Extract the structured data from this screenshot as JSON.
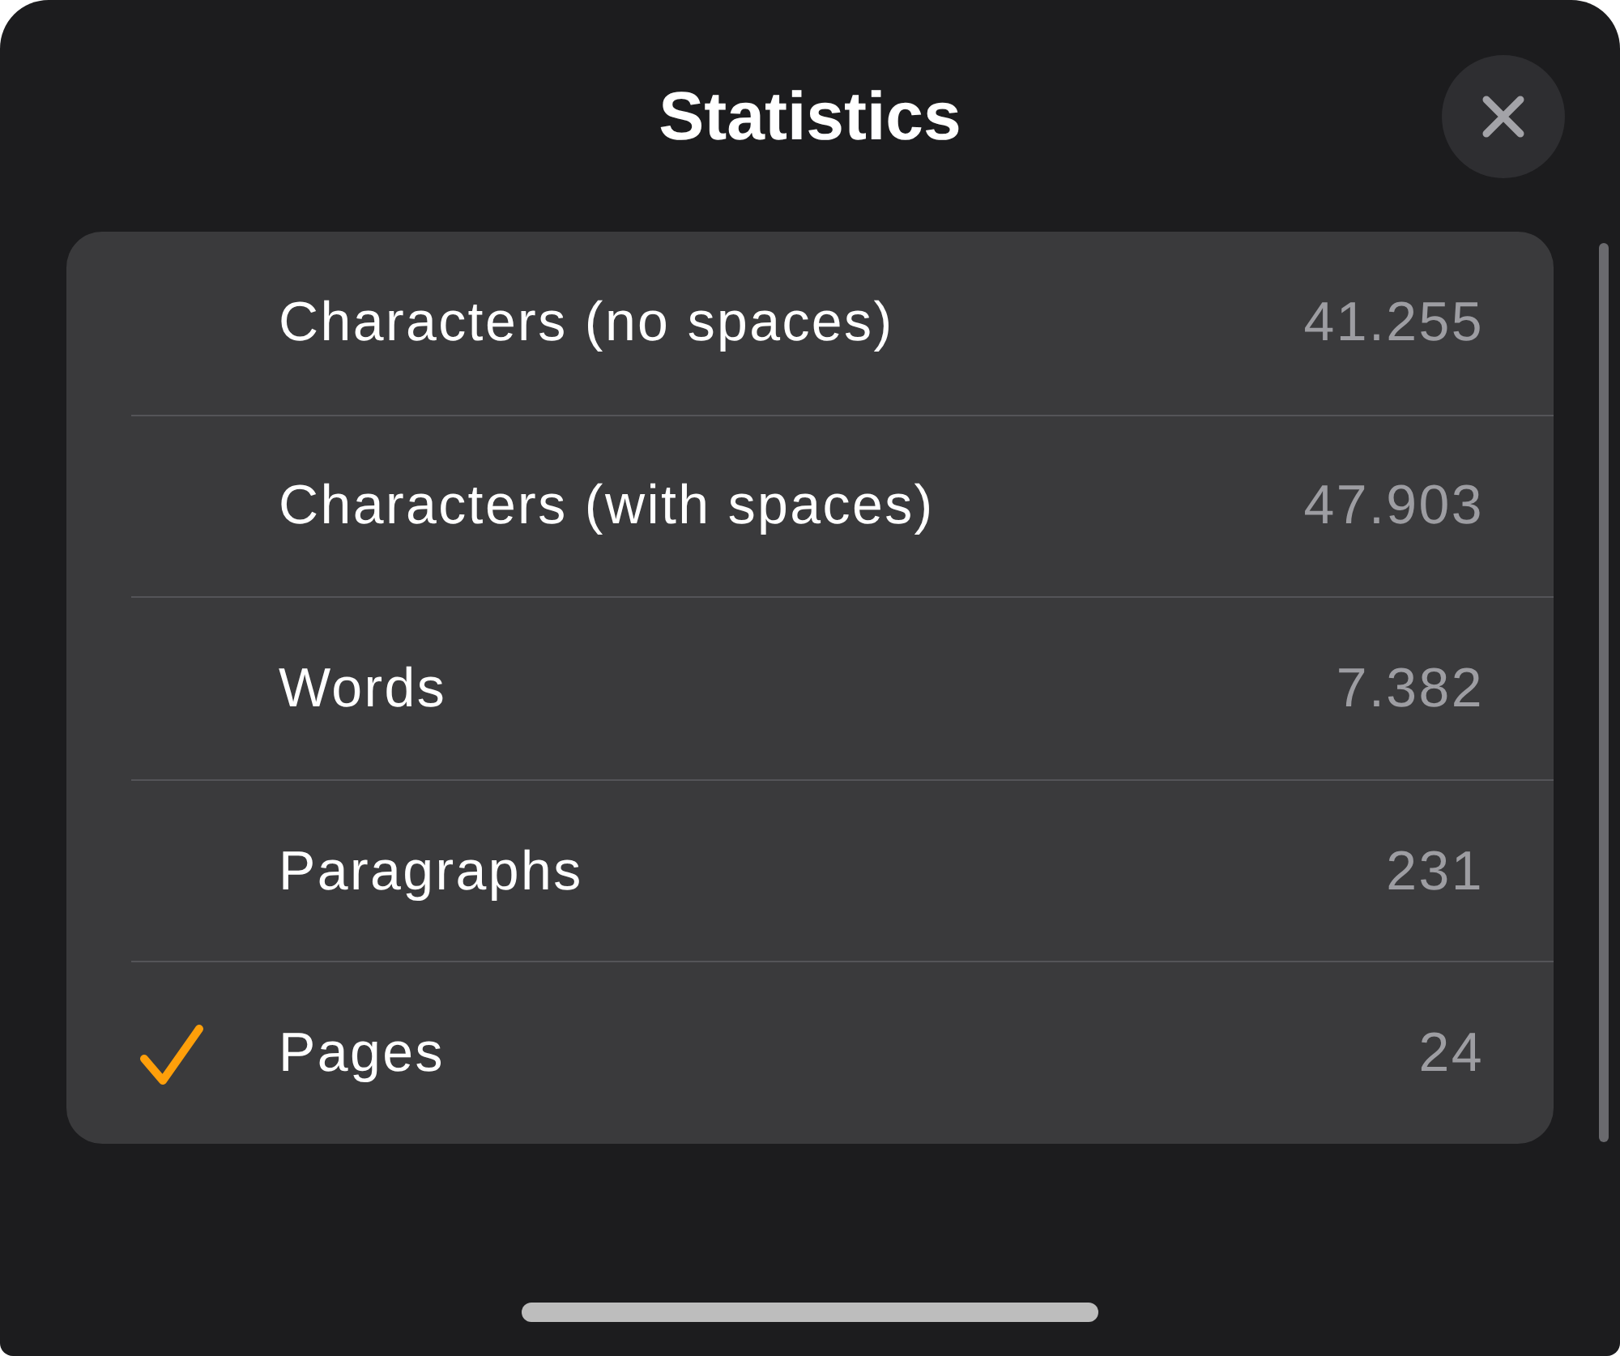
{
  "sheet": {
    "title": "Statistics"
  },
  "rows": [
    {
      "label": "Characters (no spaces)",
      "value": "41.255",
      "selected": false
    },
    {
      "label": "Characters (with spaces)",
      "value": "47.903",
      "selected": false
    },
    {
      "label": "Words",
      "value": "7.382",
      "selected": false
    },
    {
      "label": "Paragraphs",
      "value": "231",
      "selected": false
    },
    {
      "label": "Pages",
      "value": "24",
      "selected": true
    }
  ]
}
